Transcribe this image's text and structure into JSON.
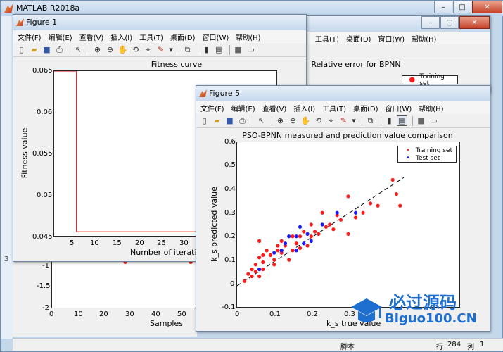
{
  "main": {
    "title": "MATLAB R2018a",
    "statusbar": {
      "mode": "脚本",
      "row_label": "行",
      "row": "284",
      "col_label": "列",
      "col": "1"
    },
    "left_glyph": "3"
  },
  "menu_items": [
    "文件(F)",
    "编辑(E)",
    "查看(V)",
    "插入(I)",
    "工具(T)",
    "桌面(D)",
    "窗口(W)",
    "帮助(H)"
  ],
  "toolbar_icons": [
    "new-file-icon",
    "open-file-icon",
    "save-icon",
    "print-icon",
    "pointer-icon",
    "zoom-in-icon",
    "zoom-out-icon",
    "pan-icon",
    "rotate-icon",
    "data-cursor-icon",
    "brush-icon",
    "link-icon",
    "colorbar-icon",
    "legend-icon",
    "hide-tools-icon",
    "show-tools-icon"
  ],
  "bg_figure": {
    "menu_visible": [
      "工具(T)",
      "桌面(D)",
      "窗口(W)",
      "帮助(H)"
    ],
    "title": "Relative error for BPNN",
    "legend": [
      "Training set"
    ],
    "xlabel": "Samples",
    "ytick_labels": [
      "-1",
      "-1.5",
      "-2"
    ],
    "xtick_labels": [
      "0",
      "10",
      "20",
      "30",
      "40",
      "50"
    ],
    "points": [
      [
        28.5,
        -1.0
      ],
      [
        54,
        -1.0
      ]
    ]
  },
  "figure1": {
    "title": "Figure 1",
    "chart_data": {
      "type": "line",
      "title": "Fitness curve",
      "xlabel": "Number of iteration",
      "ylabel": "Fitness value",
      "ylim": [
        0.045,
        0.065
      ],
      "xlim": [
        0,
        50
      ],
      "yticks": [
        "0.065",
        "0.06",
        "0.055",
        "0.05",
        "0.045"
      ],
      "xticks": [
        "5",
        "10",
        "15",
        "20",
        "25",
        "30",
        "35",
        "40"
      ],
      "x": [
        0,
        5,
        5,
        50
      ],
      "y": [
        0.065,
        0.065,
        0.0455,
        0.0455
      ],
      "color": "#e52b2b"
    }
  },
  "figure5": {
    "title": "Figure 5",
    "chart_data": {
      "type": "scatter",
      "title": "PSO-BPNN measured and prediction value comparison",
      "xlabel": "k_s true value",
      "ylabel": "k_s predicted value",
      "xlim": [
        0,
        0.6
      ],
      "ylim": [
        -0.1,
        0.6
      ],
      "yticks": [
        "0.6",
        "0.5",
        "0.4",
        "0.3",
        "0.2",
        "0.1",
        "0",
        "-0.1"
      ],
      "xticks": [
        "0",
        "0.1",
        "0.2",
        "0.3"
      ],
      "legend": [
        "Training set",
        "Test set"
      ],
      "series": [
        {
          "name": "Training set",
          "color": "#ff1a1a",
          "points": [
            [
              0.02,
              0.01
            ],
            [
              0.03,
              0.04
            ],
            [
              0.04,
              0.03
            ],
            [
              0.04,
              0.06
            ],
            [
              0.05,
              0.05
            ],
            [
              0.05,
              0.08
            ],
            [
              0.06,
              0.03
            ],
            [
              0.06,
              0.11
            ],
            [
              0.07,
              0.06
            ],
            [
              0.07,
              0.09
            ],
            [
              0.07,
              0.12
            ],
            [
              0.08,
              0.14
            ],
            [
              0.09,
              0.12
            ],
            [
              0.1,
              0.1
            ],
            [
              0.1,
              0.08
            ],
            [
              0.11,
              0.14
            ],
            [
              0.12,
              0.18
            ],
            [
              0.12,
              0.13
            ],
            [
              0.13,
              0.16
            ],
            [
              0.14,
              0.1
            ],
            [
              0.15,
              0.14
            ],
            [
              0.15,
              0.2
            ],
            [
              0.16,
              0.17
            ],
            [
              0.17,
              0.15
            ],
            [
              0.17,
              0.2
            ],
            [
              0.18,
              0.22
            ],
            [
              0.19,
              0.16
            ],
            [
              0.2,
              0.2
            ],
            [
              0.2,
              0.25
            ],
            [
              0.21,
              0.22
            ],
            [
              0.22,
              0.21
            ],
            [
              0.23,
              0.3
            ],
            [
              0.24,
              0.24
            ],
            [
              0.25,
              0.25
            ],
            [
              0.26,
              0.23
            ],
            [
              0.27,
              0.29
            ],
            [
              0.28,
              0.27
            ],
            [
              0.3,
              0.21
            ],
            [
              0.3,
              0.37
            ],
            [
              0.32,
              0.28
            ],
            [
              0.34,
              0.3
            ],
            [
              0.36,
              0.34
            ],
            [
              0.38,
              0.33
            ],
            [
              0.42,
              0.44
            ],
            [
              0.43,
              0.38
            ],
            [
              0.44,
              0.33
            ],
            [
              0.06,
              0.18
            ],
            [
              0.11,
              0.16
            ]
          ]
        },
        {
          "name": "Test set",
          "color": "#1a1aff",
          "points": [
            [
              0.06,
              0.06
            ],
            [
              0.1,
              0.13
            ],
            [
              0.12,
              0.14
            ],
            [
              0.13,
              0.17
            ],
            [
              0.14,
              0.2
            ],
            [
              0.16,
              0.2
            ],
            [
              0.17,
              0.24
            ],
            [
              0.18,
              0.17
            ],
            [
              0.19,
              0.21
            ],
            [
              0.23,
              0.25
            ],
            [
              0.27,
              0.3
            ],
            [
              0.32,
              0.3
            ],
            [
              0.2,
              0.18
            ],
            [
              0.16,
              0.14
            ]
          ]
        }
      ],
      "reference_line": {
        "from": [
          0.0,
          -0.01
        ],
        "to": [
          0.45,
          0.45
        ],
        "style": "dashed",
        "color": "#000000"
      }
    }
  },
  "watermark": {
    "text": "必过源码",
    "sub": "Biguo100.CN"
  }
}
